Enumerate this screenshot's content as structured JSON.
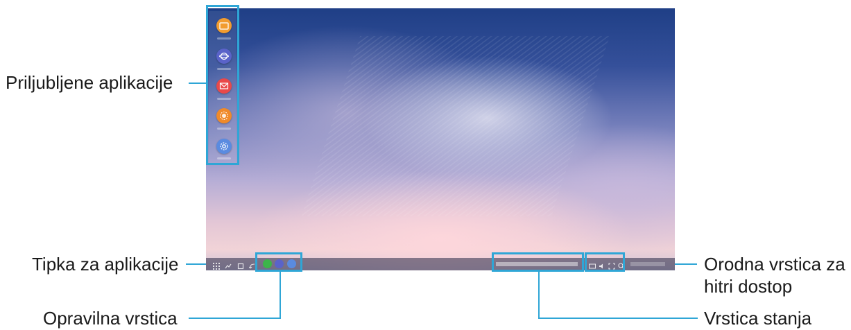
{
  "labels": {
    "favorites": "Priljubljene aplikacije",
    "apps_button": "Tipka za aplikacije",
    "taskbar": "Opravilna vrstica",
    "quick_access_line1": "Orodna vrstica za",
    "quick_access_line2": "hitri dostop",
    "status_bar": "Vrstica stanja"
  },
  "favorite_apps": [
    {
      "icon": "folder-icon",
      "color": "#f29c2f"
    },
    {
      "icon": "internet-icon",
      "color": "#5a63c9"
    },
    {
      "icon": "email-icon",
      "color": "#e9494a"
    },
    {
      "icon": "gallery-icon",
      "color": "#f08a2a"
    },
    {
      "icon": "settings-icon",
      "color": "#5a8be0"
    }
  ],
  "colors": {
    "callout": "#2fa6d6",
    "text": "#1a1a1a"
  }
}
